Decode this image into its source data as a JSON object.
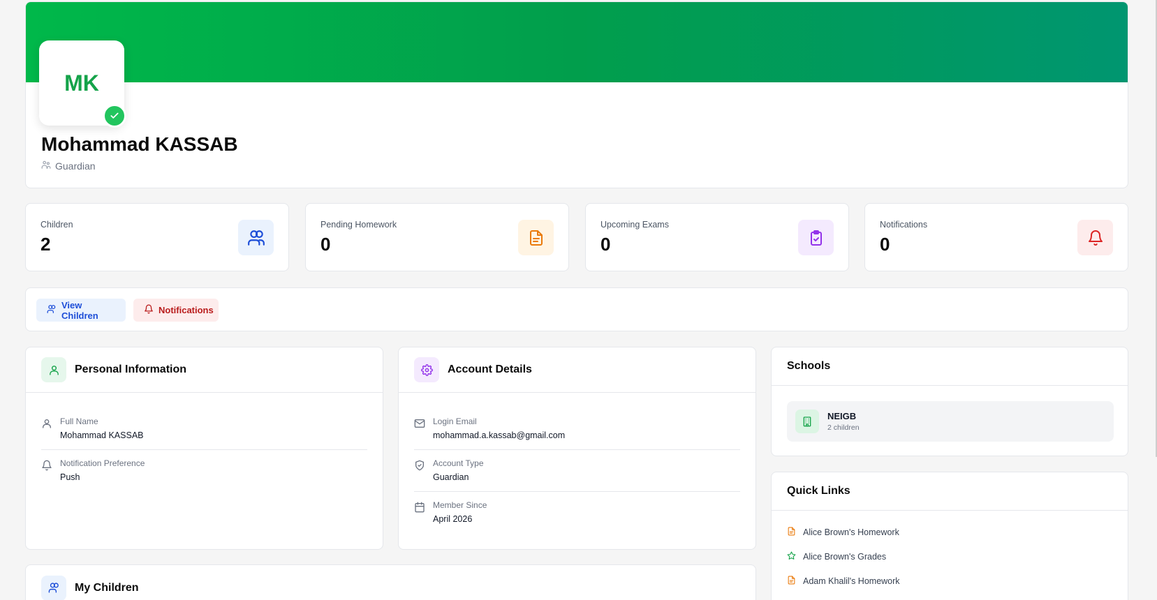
{
  "profile": {
    "initials": "MK",
    "name": "Mohammad KASSAB",
    "role": "Guardian"
  },
  "stats": [
    {
      "label": "Children",
      "value": "2",
      "icon": "users-icon",
      "color": "#1d4ed8",
      "bg": "#eaf2fd"
    },
    {
      "label": "Pending Homework",
      "value": "0",
      "icon": "document-icon",
      "color": "#ea7a0b",
      "bg": "#fff4e3"
    },
    {
      "label": "Upcoming Exams",
      "value": "0",
      "icon": "clipboard-check-icon",
      "color": "#9333ea",
      "bg": "#f4eafe"
    },
    {
      "label": "Notifications",
      "value": "0",
      "icon": "bell-icon",
      "color": "#dc2626",
      "bg": "#fdecec"
    }
  ],
  "actions": {
    "view_children": "View Children",
    "notifications": "Notifications"
  },
  "personal_info": {
    "title": "Personal Information",
    "fields": [
      {
        "label": "Full Name",
        "value": "Mohammad KASSAB",
        "icon": "user-icon"
      },
      {
        "label": "Notification Preference",
        "value": "Push",
        "icon": "bell-icon"
      }
    ]
  },
  "account_details": {
    "title": "Account Details",
    "fields": [
      {
        "label": "Login Email",
        "value": "mohammad.a.kassab@gmail.com",
        "icon": "mail-icon"
      },
      {
        "label": "Account Type",
        "value": "Guardian",
        "icon": "shield-icon"
      },
      {
        "label": "Member Since",
        "value": "April 2026",
        "icon": "calendar-icon"
      }
    ]
  },
  "schools": {
    "title": "Schools",
    "items": [
      {
        "name": "NEIGB",
        "sub": "2 children"
      }
    ]
  },
  "quick_links": {
    "title": "Quick Links",
    "items": [
      {
        "label": "Alice Brown's Homework",
        "icon": "document-icon"
      },
      {
        "label": "Alice Brown's Grades",
        "icon": "star-icon"
      },
      {
        "label": "Adam Khalil's Homework",
        "icon": "document-icon"
      }
    ]
  },
  "my_children": {
    "title": "My Children"
  },
  "colors": {
    "brand_green": "#00b84a",
    "accent_green": "#15a34a"
  }
}
